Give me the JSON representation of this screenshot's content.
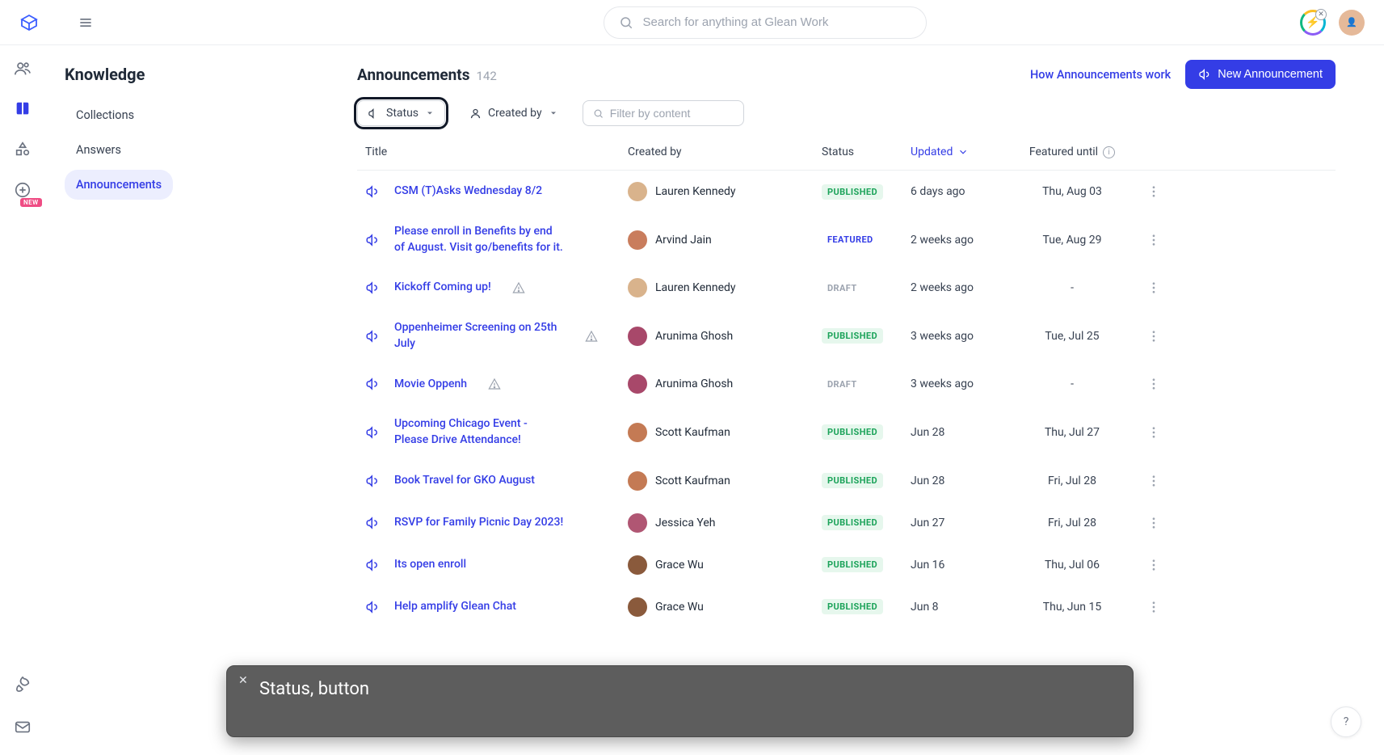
{
  "search": {
    "placeholder": "Search for anything at Glean Work"
  },
  "rail": {
    "new_badge": "NEW"
  },
  "sidebar": {
    "title": "Knowledge",
    "items": [
      {
        "label": "Collections"
      },
      {
        "label": "Answers"
      },
      {
        "label": "Announcements"
      }
    ]
  },
  "header": {
    "title": "Announcements",
    "count": "142",
    "how_link": "How Announcements work",
    "new_button": "New Announcement"
  },
  "filters": {
    "status_label": "Status",
    "created_by_label": "Created by",
    "content_placeholder": "Filter by content"
  },
  "columns": {
    "title": "Title",
    "author": "Created by",
    "status": "Status",
    "updated": "Updated",
    "featured": "Featured until"
  },
  "rows": [
    {
      "title": "CSM (T)Asks Wednesday 8/2",
      "warn": false,
      "author": "Lauren Kennedy",
      "avatar_bg": "#d9b38c",
      "status": "PUBLISHED",
      "updated": "6 days ago",
      "featured": "Thu, Aug 03"
    },
    {
      "title": "Please enroll in Benefits by end of August. Visit go/benefits for it.",
      "warn": false,
      "author": "Arvind Jain",
      "avatar_bg": "#c97d5d",
      "status": "FEATURED",
      "updated": "2 weeks ago",
      "featured": "Tue, Aug 29"
    },
    {
      "title": "Kickoff Coming up!",
      "warn": true,
      "author": "Lauren Kennedy",
      "avatar_bg": "#d9b38c",
      "status": "DRAFT",
      "updated": "2 weeks ago",
      "featured": "-"
    },
    {
      "title": "Oppenheimer Screening on 25th July",
      "warn": true,
      "author": "Arunima Ghosh",
      "avatar_bg": "#a8486a",
      "status": "PUBLISHED",
      "updated": "3 weeks ago",
      "featured": "Tue, Jul 25"
    },
    {
      "title": "Movie Oppenh",
      "warn": true,
      "author": "Arunima Ghosh",
      "avatar_bg": "#a8486a",
      "status": "DRAFT",
      "updated": "3 weeks ago",
      "featured": "-"
    },
    {
      "title": "Upcoming Chicago Event - Please Drive Attendance!",
      "warn": false,
      "author": "Scott Kaufman",
      "avatar_bg": "#c47a54",
      "status": "PUBLISHED",
      "updated": "Jun 28",
      "featured": "Thu, Jul 27"
    },
    {
      "title": "Book Travel for GKO August",
      "warn": false,
      "author": "Scott Kaufman",
      "avatar_bg": "#c47a54",
      "status": "PUBLISHED",
      "updated": "Jun 28",
      "featured": "Fri, Jul 28"
    },
    {
      "title": "RSVP for Family Picnic Day 2023!",
      "warn": false,
      "author": "Jessica Yeh",
      "avatar_bg": "#b05673",
      "status": "PUBLISHED",
      "updated": "Jun 27",
      "featured": "Fri, Jul 28"
    },
    {
      "title": "Its open enroll",
      "warn": false,
      "author": "Grace Wu",
      "avatar_bg": "#8a5a3c",
      "status": "PUBLISHED",
      "updated": "Jun 16",
      "featured": "Thu, Jul 06"
    },
    {
      "title": "Help amplify Glean Chat",
      "warn": false,
      "author": "Grace Wu",
      "avatar_bg": "#8a5a3c",
      "status": "PUBLISHED",
      "updated": "Jun 8",
      "featured": "Thu, Jun 15"
    }
  ],
  "tooltip": {
    "text": "Status, button"
  },
  "help": {
    "label": "?"
  }
}
